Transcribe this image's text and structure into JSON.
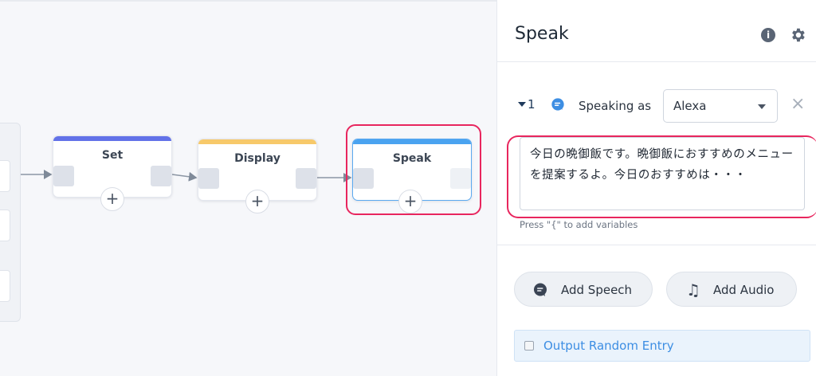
{
  "canvas": {
    "nodes": [
      {
        "id": "set",
        "title": "Set",
        "accent": "#6272e8"
      },
      {
        "id": "display",
        "title": "Display",
        "accent": "#f7c96a"
      },
      {
        "id": "speak",
        "title": "Speak",
        "accent": "#4aa3f0"
      }
    ],
    "add_symbol": "+"
  },
  "panel": {
    "title": "Speak",
    "info_icon": "i",
    "entry": {
      "number": "1",
      "speaking_as_label": "Speaking as",
      "voice": "Alexa",
      "close_icon": "×",
      "text": "今日の晩御飯です。晩御飯におすすめのメニューを提案するよ。今日のおすすめは・・・",
      "hint": "Press \"{\" to add variables"
    },
    "buttons": {
      "add_speech": "Add Speech",
      "add_audio": "Add Audio"
    },
    "random_entry_label": "Output Random Entry"
  },
  "colors": {
    "highlight": "#e8265e",
    "link": "#3d8ee3"
  }
}
